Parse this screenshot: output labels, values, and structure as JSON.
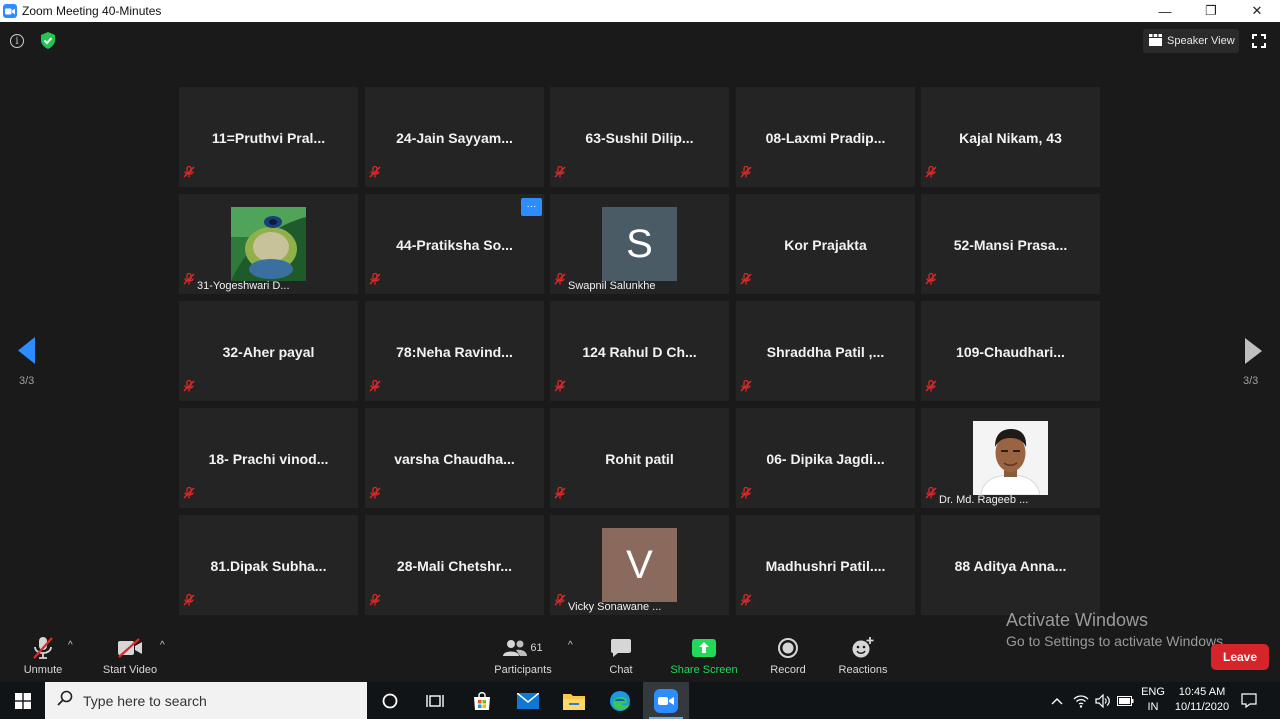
{
  "window": {
    "title": "Zoom Meeting 40-Minutes",
    "minimize": "—",
    "restore": "❐",
    "close": "✕"
  },
  "topbar": {
    "info_glyph": "i",
    "speaker_view": "Speaker View"
  },
  "pagination": {
    "left_label": "3/3",
    "right_label": "3/3"
  },
  "participants": [
    {
      "name": "11=Pruthvi  Pral...",
      "muted": true
    },
    {
      "name": "24-Jain  Sayyam...",
      "muted": true
    },
    {
      "name": "63-Sushil  Dilip...",
      "muted": true
    },
    {
      "name": "08-Laxmi  Pradip...",
      "muted": true
    },
    {
      "name": "Kajal Nikam, 43",
      "muted": true
    },
    {
      "name": "31-Yogeshwari D...",
      "muted": true,
      "avatar": "peacock-feather-photo"
    },
    {
      "name": "44-Pratiksha  So...",
      "muted": true,
      "more_button": "···"
    },
    {
      "name": "Swapnil Salunkhe",
      "muted": true,
      "avatar_letter": "S",
      "avatar_color": "#4a5b66"
    },
    {
      "name": "Kor Prajakta",
      "muted": true
    },
    {
      "name": "52-Mansi  Prasa...",
      "muted": true
    },
    {
      "name": "32-Aher payal",
      "muted": true
    },
    {
      "name": "78:Neha  Ravind...",
      "muted": true
    },
    {
      "name": "124 Rahul D Ch...",
      "muted": true
    },
    {
      "name": "Shraddha  Patil  ,...",
      "muted": true
    },
    {
      "name": "109-Chaudhari...",
      "muted": true
    },
    {
      "name": "18-  Prachi  vinod...",
      "muted": true
    },
    {
      "name": "varsha  Chaudha...",
      "muted": true
    },
    {
      "name": "Rohit patil",
      "muted": true
    },
    {
      "name": "06-  Dipika  Jagdi...",
      "muted": true
    },
    {
      "name": "Dr. Md. Rageeb ...",
      "muted": true,
      "avatar": "man-portrait-photo"
    },
    {
      "name": "81.Dipak  Subha...",
      "muted": true
    },
    {
      "name": "28-Mali  Chetshr...",
      "muted": true
    },
    {
      "name": "Vicky Sonawane ...",
      "muted": true,
      "avatar_letter": "V",
      "avatar_color": "#8a6a5c"
    },
    {
      "name": "Madhushri  Patil....",
      "muted": true
    },
    {
      "name": "88 Aditya  Anna...",
      "muted": true
    }
  ],
  "activate_windows": {
    "title": "Activate Windows",
    "subtitle": "Go to Settings to activate Windows."
  },
  "toolbar": {
    "unmute": "Unmute",
    "start_video": "Start Video",
    "participants": "Participants",
    "participant_count": "61",
    "chat": "Chat",
    "share_screen": "Share Screen",
    "record": "Record",
    "reactions": "Reactions",
    "leave": "Leave",
    "caret": "^"
  },
  "taskbar": {
    "search_placeholder": "Type here to search",
    "lang_line1": "ENG",
    "lang_line2": "IN",
    "time": "10:45 AM",
    "date": "10/11/2020"
  },
  "colors": {
    "background": "#1a1a1a",
    "tile": "#242424",
    "mute_red": "#e02828",
    "zoom_blue": "#2d8cff",
    "share_green": "#23d959",
    "leave_red": "#d6252a"
  }
}
